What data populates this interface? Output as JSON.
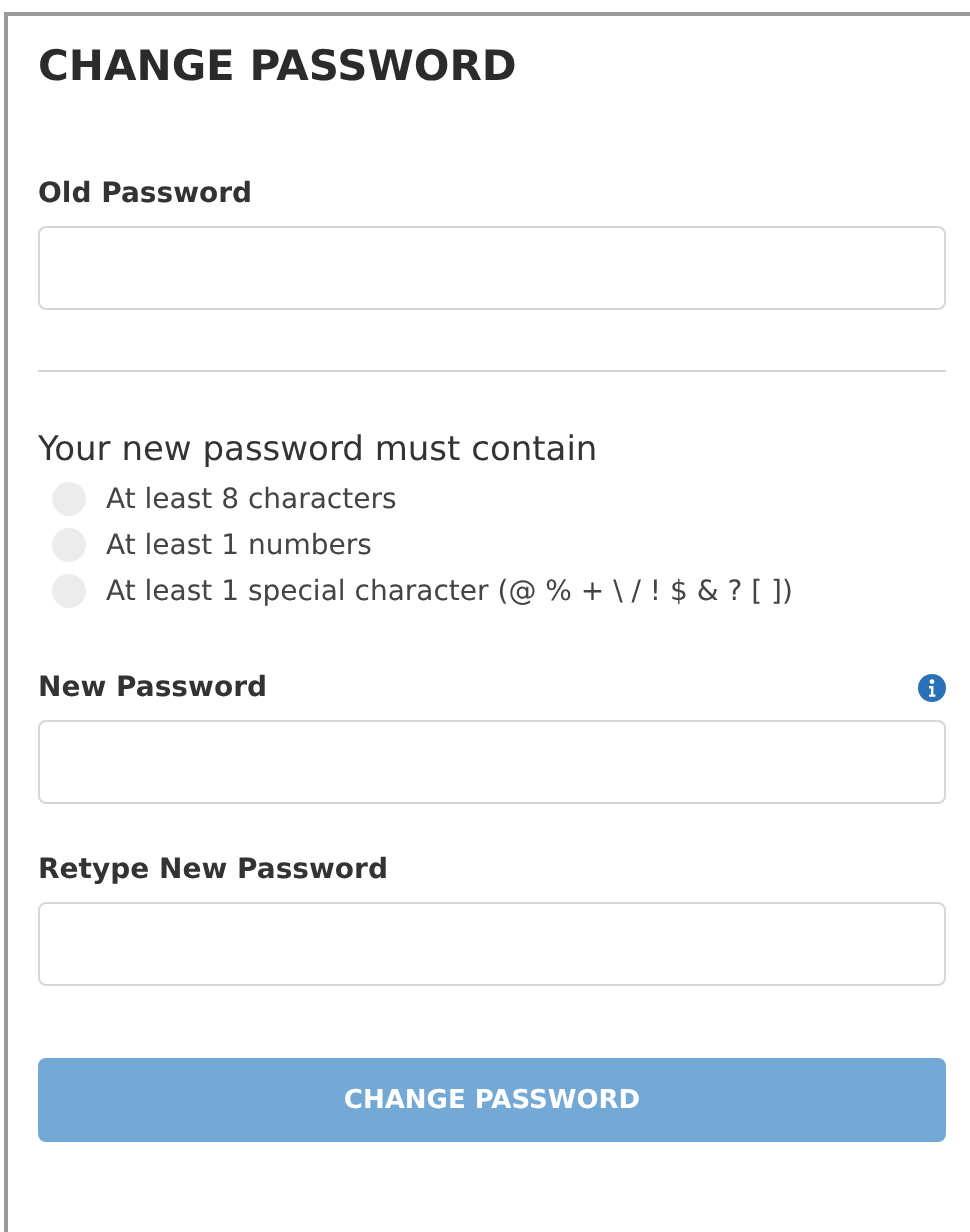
{
  "title": "CHANGE PASSWORD",
  "old_password": {
    "label": "Old Password"
  },
  "requirements": {
    "heading": "Your new password must contain",
    "items": [
      {
        "text": "At least 8 characters",
        "met": false
      },
      {
        "text": "At least 1 numbers",
        "met": false
      },
      {
        "text": "At least 1 special character (@ % + \\ / ! $ & ? [ ])",
        "met": false
      }
    ]
  },
  "new_password": {
    "label": "New Password",
    "info": true
  },
  "retype_password": {
    "label": "Retype New Password"
  },
  "submit": {
    "label": "CHANGE PASSWORD",
    "disabled": true
  }
}
